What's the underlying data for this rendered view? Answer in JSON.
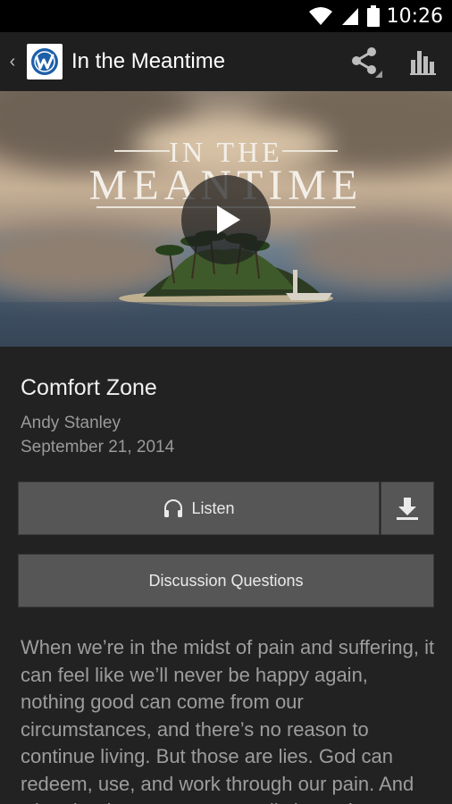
{
  "status_bar": {
    "time": "10:26",
    "icons": [
      "wifi-icon",
      "cellular-signal-icon",
      "battery-icon"
    ]
  },
  "app_bar": {
    "back_glyph": "‹",
    "logo_icon": "app-logo-w-icon",
    "title": "In the Meantime",
    "actions": [
      "share-icon",
      "bar-chart-icon"
    ]
  },
  "hero": {
    "series_title_top": "IN THE",
    "series_title_main": "MEANTIME",
    "play_icon": "play-icon"
  },
  "message": {
    "title": "Comfort Zone",
    "speaker": "Andy Stanley",
    "date": "September 21, 2014"
  },
  "buttons": {
    "listen_label": "Listen",
    "listen_icon": "headphones-icon",
    "download_icon": "download-icon",
    "discussion_label": "Discussion Questions"
  },
  "description": "When we’re in the midst of pain and suffering, it can feel like we’ll never be happy again, nothing good can come from our circumstances, and there’s no reason to continue living. But those are lies. God can redeem, use, and work through our pain. And when he does, we can actually learn the",
  "colors": {
    "background": "#222222",
    "app_bar": "#1f1f1f",
    "button": "#565656",
    "secondary_text": "#9a9a9a"
  }
}
